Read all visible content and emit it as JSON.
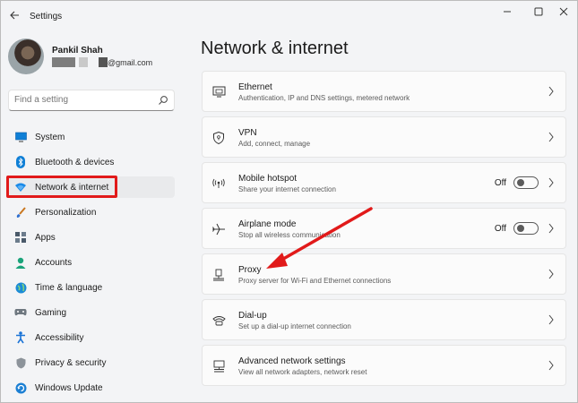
{
  "window": {
    "title": "Settings"
  },
  "profile": {
    "name": "Pankil Shah",
    "email_suffix": "@gmail.com"
  },
  "search": {
    "placeholder": "Find a setting"
  },
  "sidebar": {
    "items": [
      {
        "label": "System",
        "icon": "monitor-icon"
      },
      {
        "label": "Bluetooth & devices",
        "icon": "bluetooth-icon"
      },
      {
        "label": "Network & internet",
        "icon": "wifi-icon",
        "active": true
      },
      {
        "label": "Personalization",
        "icon": "brush-icon"
      },
      {
        "label": "Apps",
        "icon": "apps-icon"
      },
      {
        "label": "Accounts",
        "icon": "person-icon"
      },
      {
        "label": "Time & language",
        "icon": "globe-icon"
      },
      {
        "label": "Gaming",
        "icon": "gamepad-icon"
      },
      {
        "label": "Accessibility",
        "icon": "accessibility-icon"
      },
      {
        "label": "Privacy & security",
        "icon": "shield-icon"
      },
      {
        "label": "Windows Update",
        "icon": "update-icon"
      }
    ]
  },
  "main": {
    "title": "Network & internet",
    "cards": [
      {
        "title": "Ethernet",
        "subtitle": "Authentication, IP and DNS settings, metered network",
        "icon": "ethernet-icon"
      },
      {
        "title": "VPN",
        "subtitle": "Add, connect, manage",
        "icon": "vpn-shield-icon"
      },
      {
        "title": "Mobile hotspot",
        "subtitle": "Share your internet connection",
        "icon": "hotspot-icon",
        "toggle": "Off"
      },
      {
        "title": "Airplane mode",
        "subtitle": "Stop all wireless communication",
        "icon": "airplane-icon",
        "toggle": "Off"
      },
      {
        "title": "Proxy",
        "subtitle": "Proxy server for Wi-Fi and Ethernet connections",
        "icon": "proxy-icon"
      },
      {
        "title": "Dial-up",
        "subtitle": "Set up a dial-up internet connection",
        "icon": "dialup-icon"
      },
      {
        "title": "Advanced network settings",
        "subtitle": "View all network adapters, network reset",
        "icon": "network-adapter-icon"
      }
    ]
  },
  "colors": {
    "annotation": "#e11a1a",
    "accent": "#0067c0"
  }
}
